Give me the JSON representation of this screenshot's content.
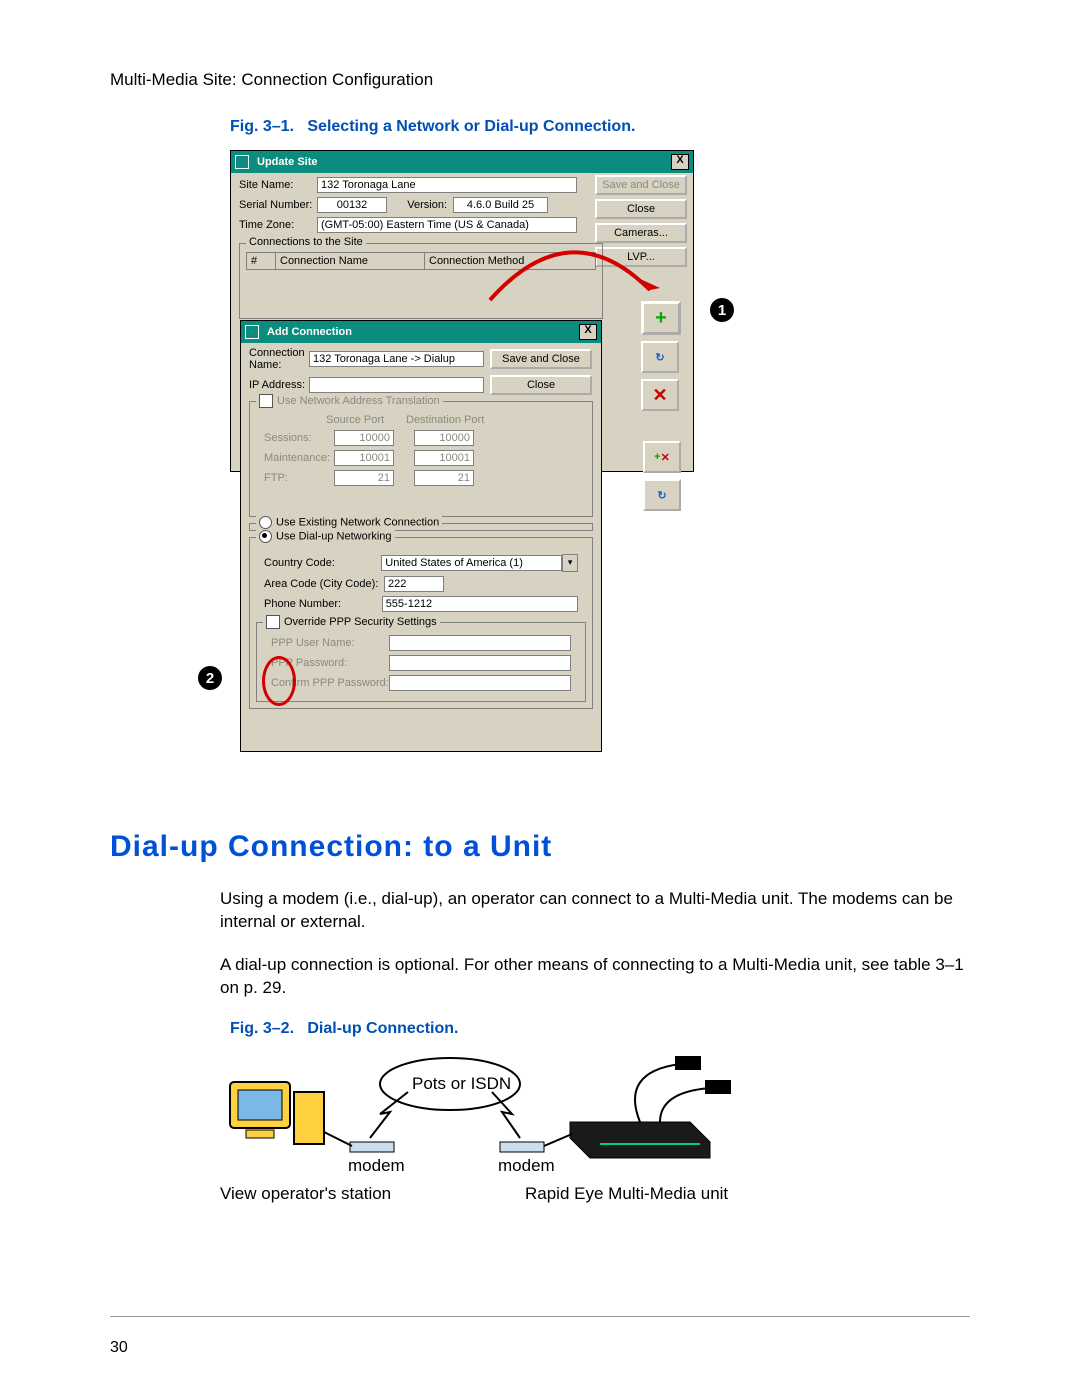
{
  "breadcrumb": "Multi-Media Site: Connection Configuration",
  "fig1_caption_label": "Fig. 3–1.",
  "fig1_caption_text": "Selecting a Network or Dial-up Connection.",
  "updateSite": {
    "title": "Update Site",
    "close_x": "X",
    "labels": {
      "siteName": "Site Name:",
      "serialNumber": "Serial Number:",
      "version": "Version:",
      "timeZone": "Time Zone:"
    },
    "values": {
      "siteName": "132 Toronaga Lane",
      "serialNumber": "00132",
      "version": "4.6.0 Build 25",
      "timeZone": "(GMT-05:00) Eastern Time (US & Canada)"
    },
    "buttons": {
      "saveClose": "Save and Close",
      "close": "Close",
      "cameras": "Cameras...",
      "lvp": "LVP..."
    },
    "connections_group": "Connections to the Site",
    "list_headers": {
      "num": "#",
      "name": "Connection Name",
      "method": "Connection Method"
    }
  },
  "addConn": {
    "title": "Add Connection",
    "close_x": "X",
    "labels": {
      "connName": "Connection Name:",
      "ip": "IP Address:",
      "nat": "Use Network Address Translation",
      "srcPort": "Source Port",
      "dstPort": "Destination Port",
      "sessions": "Sessions:",
      "maintenance": "Maintenance:",
      "ftp": "FTP:",
      "radExisting": "Use Existing Network Connection",
      "radDialup": "Use Dial-up Networking",
      "country": "Country Code:",
      "area": "Area Code (City Code):",
      "phone": "Phone Number:",
      "overridePPP": "Override PPP Security Settings",
      "pppUser": "PPP User Name:",
      "pppPass": "PPP Password:",
      "pppConfirm": "Confirm PPP Password:"
    },
    "values": {
      "connName": "132 Toronaga Lane -> Dialup",
      "ip": "",
      "sessions_src": "10000",
      "sessions_dst": "10000",
      "maint_src": "10001",
      "maint_dst": "10001",
      "ftp_src": "21",
      "ftp_dst": "21",
      "country": "United States of America (1)",
      "area": "222",
      "phone": "555-1212"
    },
    "buttons": {
      "saveClose": "Save and Close",
      "close": "Close"
    }
  },
  "section_heading": "Dial-up Connection: to a Unit",
  "para1": "Using a modem (i.e., dial-up), an operator can connect to a Multi-Media unit. The modems can be internal or external.",
  "para2": "A dial-up connection is optional. For other means of connecting to a Multi-Media unit, see table 3–1 on p. 29.",
  "fig2_caption_label": "Fig. 3–2.",
  "fig2_caption_text": "Dial-up Connection.",
  "diagram": {
    "cloud": "Pots or ISDN",
    "modem_left": "modem",
    "modem_right": "modem",
    "caption_left": "View operator's station",
    "caption_right": "Rapid Eye Multi-Media unit"
  },
  "page_number": "30",
  "callouts": {
    "one": "1",
    "two": "2"
  },
  "icons": {
    "plus": "+",
    "x": "✕",
    "refresh": "↻",
    "plusx": "+✕"
  }
}
